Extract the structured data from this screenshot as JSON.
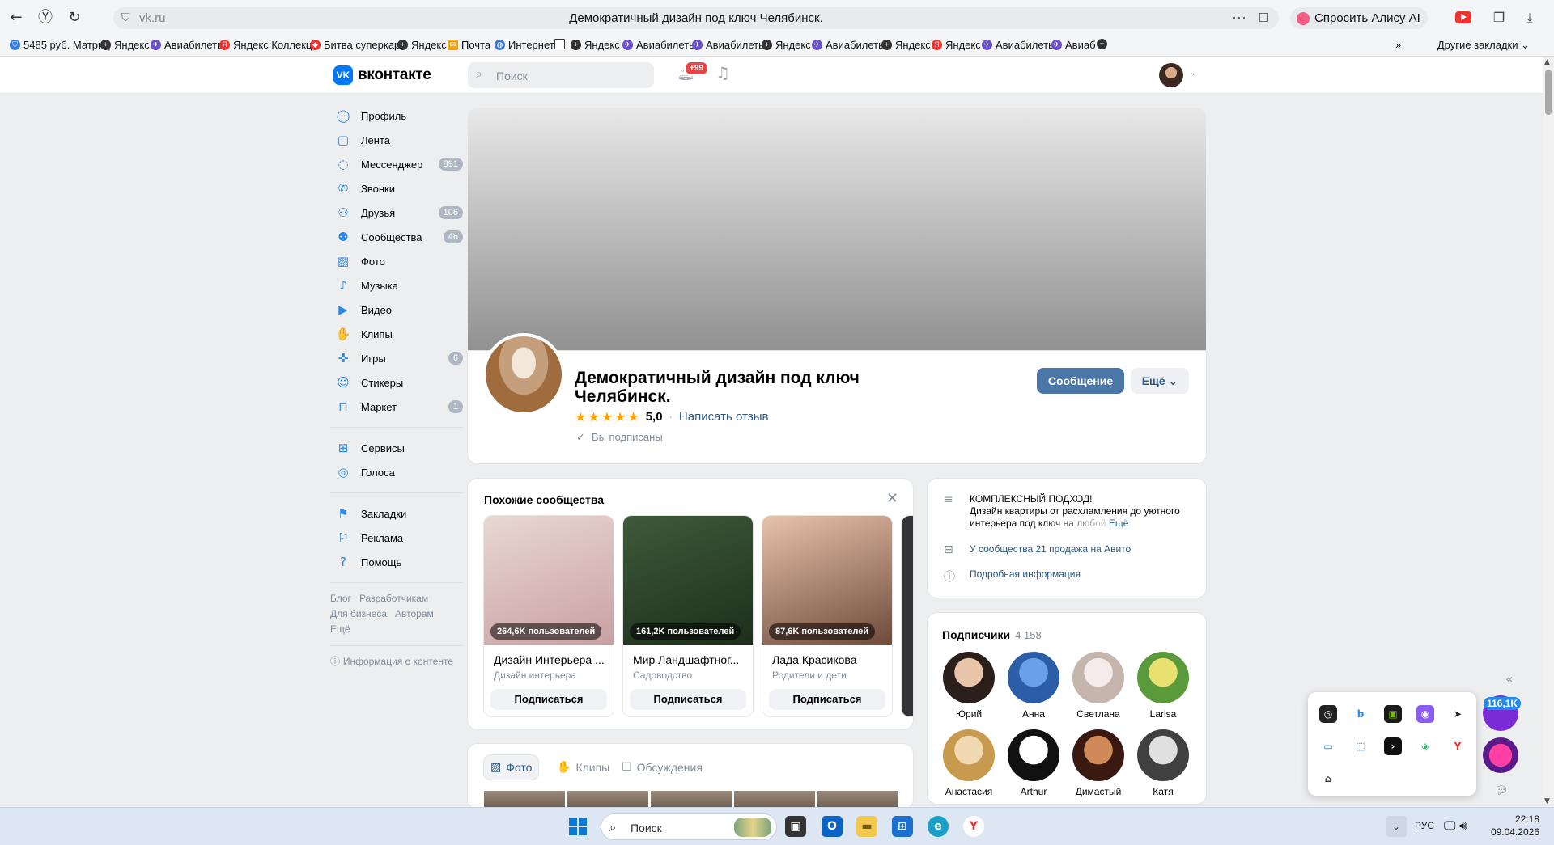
{
  "browser": {
    "url": "vk.ru",
    "page_title": "Демократичный дизайн под ключ Челябинск.",
    "alice_label": "Спросить Алису AI",
    "bookmarks": [
      {
        "label": "5485 руб. Матриц",
        "icon": "shield-icon"
      },
      {
        "label": "Яндекс",
        "icon": "plus-icon"
      },
      {
        "label": "Авиабилеты",
        "icon": "plane-icon"
      },
      {
        "label": "Яндекс.Коллекци",
        "icon": "yandex-icon"
      },
      {
        "label": "Битва суперкаро",
        "icon": "game-icon"
      },
      {
        "label": "Яндекс",
        "icon": "plus-icon"
      },
      {
        "label": "Почта",
        "icon": "mail-icon"
      },
      {
        "label": "Интернет",
        "icon": "globe-icon"
      },
      {
        "label": "",
        "icon": "file-icon"
      },
      {
        "label": "Яндекс",
        "icon": "plus-icon"
      },
      {
        "label": "Авиабилеты",
        "icon": "plane-icon"
      },
      {
        "label": "Авиабилеты",
        "icon": "plane-icon"
      },
      {
        "label": "Яндекс",
        "icon": "plus-icon"
      },
      {
        "label": "Авиабилеты",
        "icon": "plane-icon"
      },
      {
        "label": "Яндекс",
        "icon": "plus-icon"
      },
      {
        "label": "Яндекс",
        "icon": "yandex-icon"
      },
      {
        "label": "Авиабилеты",
        "icon": "plane-icon"
      },
      {
        "label": "Авиаб",
        "icon": "plane-icon"
      },
      {
        "label": "",
        "icon": "plus-icon"
      }
    ],
    "more_bookmarks": "»",
    "other_bookmarks": "Другие закладки"
  },
  "vk": {
    "logo_text": "вконтакте",
    "logo_mark": "VK",
    "search_placeholder": "Поиск",
    "notif_badge": "+99"
  },
  "sidebar": {
    "items": [
      {
        "label": "Профиль",
        "icon": "user-icon",
        "count": ""
      },
      {
        "label": "Лента",
        "icon": "feed-icon",
        "count": ""
      },
      {
        "label": "Мессенджер",
        "icon": "chat-icon",
        "count": "891"
      },
      {
        "label": "Звонки",
        "icon": "phone-icon",
        "count": ""
      },
      {
        "label": "Друзья",
        "icon": "friends-icon",
        "count": "106"
      },
      {
        "label": "Сообщества",
        "icon": "groups-icon",
        "count": "46"
      },
      {
        "label": "Фото",
        "icon": "photo-icon",
        "count": ""
      },
      {
        "label": "Музыка",
        "icon": "music-icon",
        "count": ""
      },
      {
        "label": "Видео",
        "icon": "video-icon",
        "count": ""
      },
      {
        "label": "Клипы",
        "icon": "clips-icon",
        "count": ""
      },
      {
        "label": "Игры",
        "icon": "games-icon",
        "count": "6"
      },
      {
        "label": "Стикеры",
        "icon": "sticker-icon",
        "count": ""
      },
      {
        "label": "Маркет",
        "icon": "market-icon",
        "count": "1"
      }
    ],
    "items2": [
      {
        "label": "Сервисы",
        "icon": "services-icon"
      },
      {
        "label": "Голоса",
        "icon": "votes-icon"
      }
    ],
    "items3": [
      {
        "label": "Закладки",
        "icon": "bookmark-icon"
      },
      {
        "label": "Реклама",
        "icon": "ads-icon"
      },
      {
        "label": "Помощь",
        "icon": "help-icon"
      }
    ],
    "links": [
      "Блог",
      "Разработчикам",
      "Для бизнеса",
      "Авторам",
      "Ещё"
    ],
    "content_info": "Информация о контенте"
  },
  "community": {
    "title": "Демократичный дизайн под ключ Челябинск.",
    "rating": "5,0",
    "rating_stars": 5,
    "write_review": "Написать отзыв",
    "subscribed": "Вы подписаны",
    "message_btn": "Сообщение",
    "more_btn": "Ещё"
  },
  "similar": {
    "title": "Похожие сообщества",
    "items": [
      {
        "users": "264,6K пользователей",
        "name": "Дизайн Интерьера ...",
        "category": "Дизайн интерьера",
        "btn": "Подписаться",
        "color1": "#e8d8d2",
        "color2": "#c9a0a2"
      },
      {
        "users": "161,2K пользователей",
        "name": "Мир Ландшафтног...",
        "category": "Садоводство",
        "btn": "Подписаться",
        "color1": "#3d5a3a",
        "color2": "#1e2e1c"
      },
      {
        "users": "87,6K пользователей",
        "name": "Лада Красикова",
        "category": "Родители и дети",
        "btn": "Подписаться",
        "color1": "#e9c2ab",
        "color2": "#6e4a3a"
      }
    ]
  },
  "info": {
    "desc_title": "КОМПЛЕКСНЫЙ ПОДХОД!",
    "desc_text": "Дизайн квартиры от расхламления до уютного интерьера под ключ на любой",
    "desc_more": "Ещё",
    "avito": "У сообщества 21 продажа на Авито",
    "details": "Подробная информация"
  },
  "subscribers": {
    "title": "Подписчики",
    "count": "4 158",
    "people": [
      {
        "name": "Юрий",
        "c1": "#e8c4a8",
        "c2": "#2a1f1a"
      },
      {
        "name": "Анна",
        "c1": "#6aa0e8",
        "c2": "#2c5ea8"
      },
      {
        "name": "Светлана",
        "c1": "#f3ecea",
        "c2": "#c5b5ad"
      },
      {
        "name": "Larisa",
        "c1": "#e8e070",
        "c2": "#5a9a3a"
      },
      {
        "name": "Анастасия",
        "c1": "#f0d8b0",
        "c2": "#c89a50"
      },
      {
        "name": "Arthur",
        "c1": "#ffffff",
        "c2": "#111111"
      },
      {
        "name": "Димастый",
        "c1": "#d08a5a",
        "c2": "#3a1a10"
      },
      {
        "name": "Катя",
        "c1": "#e0e0e0",
        "c2": "#404040"
      }
    ]
  },
  "tabs": [
    {
      "label": "Фото",
      "icon": "photo-icon",
      "active": true
    },
    {
      "label": "Клипы",
      "icon": "clips-icon",
      "active": false
    },
    {
      "label": "Обсуждения",
      "icon": "discussion-icon",
      "active": false
    }
  ],
  "float": {
    "badge": "116,1K"
  },
  "taskbar": {
    "search_placeholder": "Поиск",
    "lang": "РУС",
    "time": "22:18",
    "date": "09.04.2026"
  }
}
